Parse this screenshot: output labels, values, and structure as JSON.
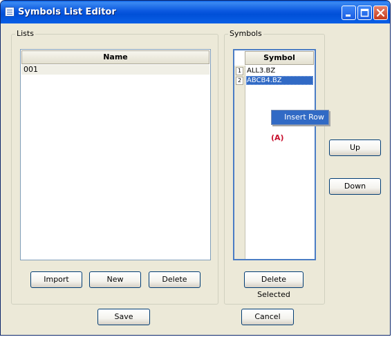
{
  "window": {
    "title": "Symbols List Editor"
  },
  "lists": {
    "label": "Lists",
    "header": "Name",
    "rows": [
      "001"
    ],
    "buttons": {
      "import": "Import",
      "new": "New",
      "delete": "Delete"
    }
  },
  "symbols": {
    "label": "Symbols",
    "header": "Symbol",
    "rows": [
      {
        "num": "1",
        "symbol": "ALL3.BZ",
        "selected": false
      },
      {
        "num": "2",
        "symbol": "ABCB4.BZ",
        "selected": true
      }
    ],
    "delete_selected": "Delete Selected"
  },
  "context_menu": {
    "insert_row": "Insert Row"
  },
  "annotation": "(A)",
  "side_buttons": {
    "up": "Up",
    "down": "Down"
  },
  "footer": {
    "save": "Save",
    "cancel": "Cancel"
  },
  "colors": {
    "titlebar": "#0a5fe5",
    "selection": "#316ac5",
    "annotation": "#c8102e",
    "window_bg": "#ece9d8"
  },
  "icons": [
    "list-app-icon",
    "minimize-icon",
    "maximize-icon",
    "close-icon"
  ]
}
